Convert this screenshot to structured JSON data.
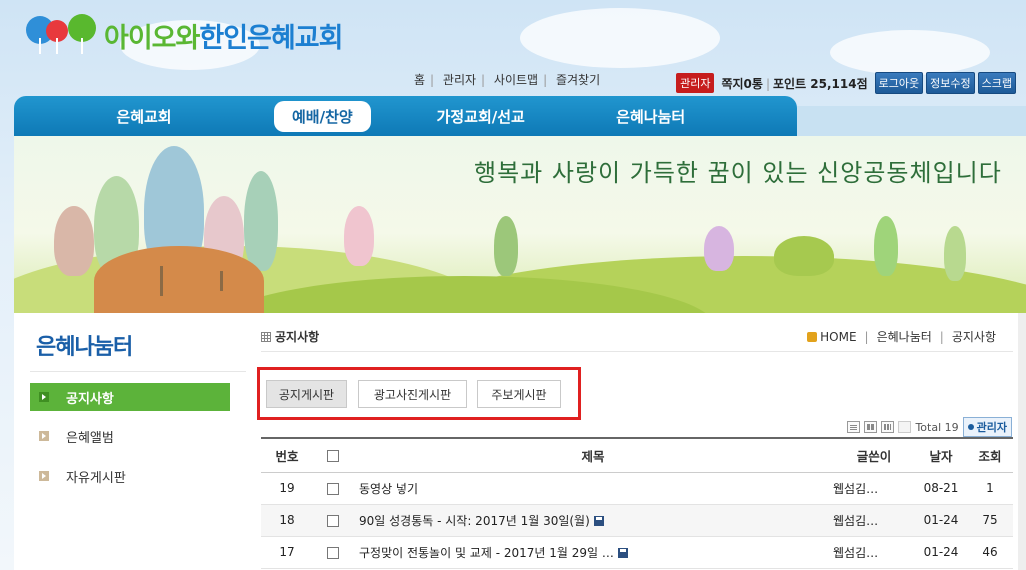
{
  "header": {
    "logo_text_a": "아이오와",
    "logo_text_b": "한인은혜교회",
    "util_links": [
      "홈",
      "관리자",
      "사이트맵",
      "즐겨찾기"
    ],
    "member": {
      "admin_badge": "관리자",
      "memo": "쪽지0통",
      "point": "포인트 25,114점",
      "logout": "로그아웃",
      "edit_info": "정보수정",
      "scrap": "스크랩"
    }
  },
  "nav": {
    "items": [
      "은혜교회",
      "예배/찬양",
      "가정교회/선교",
      "은혜나눔터"
    ],
    "active_index": 1
  },
  "banner": {
    "slogan": "행복과 사랑이 가득한 꿈이 있는 신앙공동체입니다"
  },
  "sidebar": {
    "title": "은혜나눔터",
    "items": [
      "공지사항",
      "은혜앨범",
      "자유게시판"
    ],
    "active_index": 0
  },
  "board": {
    "title": "공지사항",
    "breadcrumb": [
      "HOME",
      "은혜나눔터",
      "공지사항"
    ],
    "tabs": [
      "공지게시판",
      "광고사진게시판",
      "주보게시판"
    ],
    "active_tab": 0,
    "total": "Total 19",
    "admin_label": "관리자",
    "columns": [
      "번호",
      "",
      "제목",
      "글쓴이",
      "날자",
      "조회"
    ],
    "rows": [
      {
        "num": "19",
        "subject": "동영상 넣기",
        "author": "웹섬김…",
        "date": "08-21",
        "hits": "1",
        "file": false
      },
      {
        "num": "18",
        "subject": "90일 성경통독 - 시작: 2017년 1월 30일(월)",
        "author": "웹섬김…",
        "date": "01-24",
        "hits": "75",
        "file": true
      },
      {
        "num": "17",
        "subject": "구정맞이 전통놀이 및 교제 - 2017년 1월 29일 …",
        "author": "웹섬김…",
        "date": "01-24",
        "hits": "46",
        "file": true
      }
    ]
  },
  "colors": {
    "nav_blue": "#1585c4",
    "active_green": "#5cb33a",
    "highlight_red": "#e02020",
    "admin_red": "#c61d1d"
  }
}
